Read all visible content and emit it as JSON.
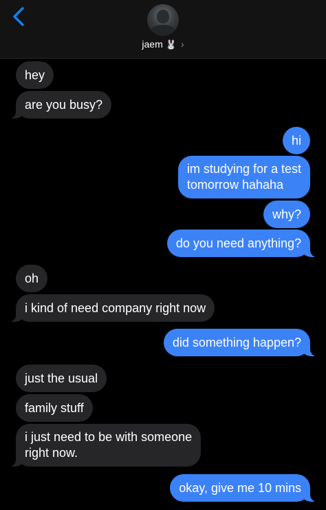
{
  "header": {
    "contact_name": "jaem",
    "contact_emoji": "🐰",
    "chevron": "›",
    "back_icon": "chevron-left-icon",
    "accent": "#0a84ff",
    "background": "#131313"
  },
  "colors": {
    "incoming_bubble": "#262629",
    "outgoing_bubble": "#3b82f6"
  },
  "messages": [
    {
      "sender": "them",
      "text": "hey"
    },
    {
      "sender": "them",
      "text": "are you busy?"
    },
    {
      "sender": "me",
      "text": "hi"
    },
    {
      "sender": "me",
      "lines": [
        "im studying for a test",
        "tomorrow hahaha"
      ]
    },
    {
      "sender": "me",
      "text": "why?"
    },
    {
      "sender": "me",
      "text": "do you need anything?"
    },
    {
      "sender": "them",
      "text": "oh"
    },
    {
      "sender": "them",
      "text": "i kind of need company right now"
    },
    {
      "sender": "me",
      "text": "did something happen?"
    },
    {
      "sender": "them",
      "text": "just the usual"
    },
    {
      "sender": "them",
      "text": "family stuff"
    },
    {
      "sender": "them",
      "lines": [
        "i just need to be with someone",
        "right now."
      ]
    },
    {
      "sender": "me",
      "text": "okay, give me 10 mins"
    }
  ]
}
